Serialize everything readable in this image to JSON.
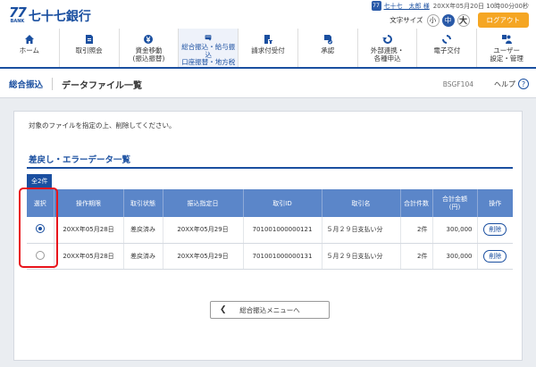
{
  "header": {
    "logo_mark": "77",
    "logo_bank": "BANK",
    "logo_name": "七十七銀行",
    "user_icon": "77",
    "user_name": "七十七　太郎 様",
    "last_login": "20XX年05月20日 10時00分00秒",
    "font_size_label": "文字サイズ",
    "font_small": "小",
    "font_medium": "中",
    "font_large": "大",
    "logout_label": "ログアウト",
    "accent_color": "#1a4fa0",
    "logout_color": "#f5a623"
  },
  "nav": {
    "items": [
      {
        "label1": "ホーム",
        "label2": "",
        "icon": "home-icon"
      },
      {
        "label1": "取引照会",
        "label2": "",
        "icon": "document-icon"
      },
      {
        "label1": "資金移動",
        "label2": "(振込振替)",
        "icon": "yen-transfer-icon"
      },
      {
        "label1": "総合振込・給与振込",
        "label2": "口座振替・地方税",
        "icon": "card-icon"
      },
      {
        "label1": "請求付受付",
        "label2": "",
        "icon": "doc-edit-icon"
      },
      {
        "label1": "承認",
        "label2": "",
        "icon": "approval-icon"
      },
      {
        "label1": "外部連携・",
        "label2": "各種申込",
        "icon": "link-icon"
      },
      {
        "label1": "電子交付",
        "label2": "",
        "icon": "cycle-icon"
      },
      {
        "label1": "ユーザー",
        "label2": "設定・管理",
        "icon": "user-settings-icon"
      }
    ]
  },
  "crumb": {
    "main": "総合振込",
    "title": "データファイル一覧",
    "screen_id": "BSGF104",
    "help": "ヘルプ",
    "help_icon": "?"
  },
  "content": {
    "instruction": "対象のファイルを指定の上、削除してください。",
    "section_title": "差戻し・エラーデータ一覧",
    "count": "全2件",
    "columns": [
      "選択",
      "操作期限",
      "取引状態",
      "振込指定日",
      "取引ID",
      "取引名",
      "合計件数",
      "合計金額\n(円)",
      "操作"
    ],
    "rows": [
      {
        "selected": true,
        "deadline": "20XX年05月28日",
        "status": "差戻済み",
        "date": "20XX年05月29日",
        "id": "701001000000121",
        "name": "５月２９日支払い分",
        "count": "2件",
        "amount": "300,000",
        "action": "削除"
      },
      {
        "selected": false,
        "deadline": "20XX年05月28日",
        "status": "差戻済み",
        "date": "20XX年05月29日",
        "id": "701001000000131",
        "name": "５月２９日支払い分",
        "count": "2件",
        "amount": "300,000",
        "action": "削除"
      }
    ],
    "back_button": "総合振込メニューへ",
    "highlight_color": "#e8141b"
  }
}
